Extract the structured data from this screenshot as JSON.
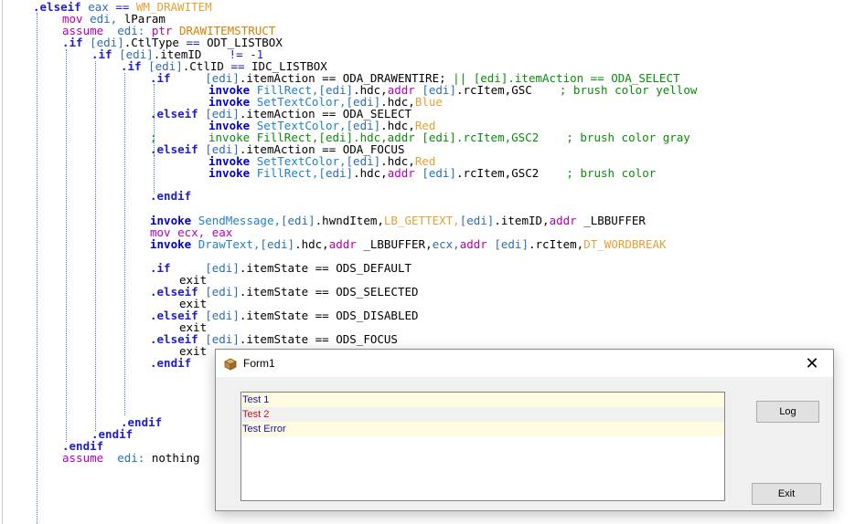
{
  "editor": {
    "lines": [
      [
        {
          "t": ".elseif ",
          "c": "kw"
        },
        {
          "t": "eax ",
          "c": "reg"
        },
        {
          "t": "== ",
          "c": "eq"
        },
        {
          "t": "WM_DRAWITEM",
          "c": "ora"
        }
      ],
      [
        {
          "t": "mov ",
          "c": "mov"
        },
        {
          "t": "edi, ",
          "c": "reg"
        },
        {
          "t": "lParam",
          "c": ""
        }
      ],
      [
        {
          "t": "assume  ",
          "c": "asm"
        },
        {
          "t": "edi: ",
          "c": "reg"
        },
        {
          "t": "ptr ",
          "c": "asm"
        },
        {
          "t": "DRAWITEMSTRUCT",
          "c": "ptr"
        }
      ],
      [
        {
          "t": ".if ",
          "c": "kw"
        },
        {
          "t": "[edi]",
          "c": "reg"
        },
        {
          "t": ".CtlType ",
          "c": ""
        },
        {
          "t": "== ",
          "c": "eq"
        },
        {
          "t": "ODT_LISTBOX",
          "c": ""
        }
      ],
      [
        {
          "t": ".if ",
          "c": "kw"
        },
        {
          "t": "[edi]",
          "c": "reg"
        },
        {
          "t": ".itemID    ",
          "c": ""
        },
        {
          "t": "!= -1",
          "c": "eq"
        }
      ],
      [
        {
          "t": ".if ",
          "c": "kw"
        },
        {
          "t": "[edi]",
          "c": "reg"
        },
        {
          "t": ".CtlID ",
          "c": ""
        },
        {
          "t": "== ",
          "c": "eq"
        },
        {
          "t": "IDC_LISTBOX",
          "c": ""
        }
      ],
      [
        {
          "t": ".if     ",
          "c": "kw"
        },
        {
          "t": "[edi]",
          "c": "reg"
        },
        {
          "t": ".itemAction == ODA_DRAWENTIRE; ",
          "c": ""
        },
        {
          "t": "|| [edi].itemAction == ODA_SELECT",
          "c": "cmt"
        }
      ],
      [
        {
          "t": "invoke ",
          "c": "inv"
        },
        {
          "t": "FillRect,",
          "c": "api"
        },
        {
          "t": "[edi]",
          "c": "reg"
        },
        {
          "t": ".hdc,",
          "c": ""
        },
        {
          "t": "addr ",
          "c": "mov"
        },
        {
          "t": "[edi]",
          "c": "reg"
        },
        {
          "t": ".rcItem,GSC    ",
          "c": ""
        },
        {
          "t": "; brush color yellow",
          "c": "cmt"
        }
      ],
      [
        {
          "t": "invoke ",
          "c": "inv"
        },
        {
          "t": "SetTextColor,",
          "c": "api"
        },
        {
          "t": "[edi]",
          "c": "reg"
        },
        {
          "t": ".hdc,",
          "c": ""
        },
        {
          "t": "Blue",
          "c": "ora"
        }
      ],
      [
        {
          "t": ".elseif ",
          "c": "kw"
        },
        {
          "t": "[edi]",
          "c": "reg"
        },
        {
          "t": ".itemAction == ODA_SELECT",
          "c": ""
        }
      ],
      [
        {
          "t": "invoke ",
          "c": "inv"
        },
        {
          "t": "SetTextColor,",
          "c": "api"
        },
        {
          "t": "[edi]",
          "c": "reg"
        },
        {
          "t": ".hdc,",
          "c": ""
        },
        {
          "t": "Red",
          "c": "ora"
        }
      ],
      [
        {
          "t": "invoke ",
          "c": "cmt"
        },
        {
          "t": "FillRect,[edi].hdc,addr [edi].rcItem,GSC2    ; brush color gray",
          "c": "cmt"
        }
      ],
      [
        {
          "t": ".elseif ",
          "c": "kw"
        },
        {
          "t": "[edi]",
          "c": "reg"
        },
        {
          "t": ".itemAction == ODA_FOCUS",
          "c": ""
        }
      ],
      [
        {
          "t": "invoke ",
          "c": "inv"
        },
        {
          "t": "SetTextColor,",
          "c": "api"
        },
        {
          "t": "[edi]",
          "c": "reg"
        },
        {
          "t": ".hdc,",
          "c": ""
        },
        {
          "t": "Red",
          "c": "ora"
        }
      ],
      [
        {
          "t": "invoke ",
          "c": "inv"
        },
        {
          "t": "FillRect,",
          "c": "api"
        },
        {
          "t": "[edi]",
          "c": "reg"
        },
        {
          "t": ".hdc,",
          "c": ""
        },
        {
          "t": "addr ",
          "c": "mov"
        },
        {
          "t": "[edi]",
          "c": "reg"
        },
        {
          "t": ".rcItem,GSC2    ",
          "c": ""
        },
        {
          "t": "; brush color",
          "c": "cmt"
        }
      ],
      [
        {
          "t": ".endif",
          "c": "kw"
        }
      ],
      [
        {
          "t": "invoke ",
          "c": "inv"
        },
        {
          "t": "SendMessage,",
          "c": "api"
        },
        {
          "t": "[edi]",
          "c": "reg"
        },
        {
          "t": ".hwndItem,",
          "c": ""
        },
        {
          "t": "LB_GETTEXT,",
          "c": "ora"
        },
        {
          "t": "[edi]",
          "c": "reg"
        },
        {
          "t": ".itemID,",
          "c": ""
        },
        {
          "t": "addr ",
          "c": "mov"
        },
        {
          "t": "_LBBUFFER",
          "c": ""
        }
      ],
      [
        {
          "t": "mov ",
          "c": "mov"
        },
        {
          "t": "ecx, eax",
          "c": "mov"
        }
      ],
      [
        {
          "t": "invoke ",
          "c": "inv"
        },
        {
          "t": "DrawText,",
          "c": "api"
        },
        {
          "t": "[edi]",
          "c": "reg"
        },
        {
          "t": ".hdc,",
          "c": ""
        },
        {
          "t": "addr ",
          "c": "mov"
        },
        {
          "t": "_LBBUFFER,",
          "c": ""
        },
        {
          "t": "ecx,",
          "c": "reg"
        },
        {
          "t": "addr ",
          "c": "mov"
        },
        {
          "t": "[edi]",
          "c": "reg"
        },
        {
          "t": ".rcItem,",
          "c": ""
        },
        {
          "t": "DT_WORDBREAK",
          "c": "ora"
        }
      ],
      [
        {
          "t": ".if     ",
          "c": "kw"
        },
        {
          "t": "[edi]",
          "c": "reg"
        },
        {
          "t": ".itemState == ODS_DEFAULT",
          "c": ""
        }
      ],
      [
        {
          "t": "exit",
          "c": ""
        }
      ],
      [
        {
          "t": ".elseif ",
          "c": "kw"
        },
        {
          "t": "[edi]",
          "c": "reg"
        },
        {
          "t": ".itemState == ODS_SELECTED",
          "c": ""
        }
      ],
      [
        {
          "t": "exit",
          "c": ""
        }
      ],
      [
        {
          "t": ".elseif ",
          "c": "kw"
        },
        {
          "t": "[edi]",
          "c": "reg"
        },
        {
          "t": ".itemState == ODS_DISABLED",
          "c": ""
        }
      ],
      [
        {
          "t": "exit",
          "c": ""
        }
      ],
      [
        {
          "t": ".elseif ",
          "c": "kw"
        },
        {
          "t": "[edi]",
          "c": "reg"
        },
        {
          "t": ".itemState == ODS_FOCUS",
          "c": ""
        }
      ],
      [
        {
          "t": "exit",
          "c": ""
        }
      ],
      [
        {
          "t": ".endif",
          "c": "kw"
        }
      ],
      [
        {
          "t": ".endif",
          "c": "kw"
        }
      ],
      [
        {
          "t": ".endif",
          "c": "kw"
        }
      ],
      [
        {
          "t": ".endif",
          "c": "kw"
        }
      ],
      [
        {
          "t": "assume  ",
          "c": "asm"
        },
        {
          "t": "edi: ",
          "c": "reg"
        },
        {
          "t": "nothing",
          "c": ""
        }
      ]
    ],
    "colors": {
      "keyword": "#1e1ec8",
      "invoke": "#0000c8",
      "api": "#1e82c8",
      "register": "#2d6eaf",
      "constant": "#e6a032",
      "comment": "#0a8c0a",
      "mov": "#b400b4"
    }
  },
  "form": {
    "title": "Form1",
    "icon": "app-icon",
    "close_glyph": "✕",
    "listbox": {
      "items": [
        {
          "text": "Test 1",
          "color": "#1414b4",
          "bg": "#fffbe1"
        },
        {
          "text": "Test 2",
          "color": "#c81414",
          "bg": "#f0f0f0"
        },
        {
          "text": "Test Error",
          "color": "#1414b4",
          "bg": "#fffbe1"
        }
      ]
    },
    "log_label": "Log",
    "exit_label": "Exit"
  }
}
